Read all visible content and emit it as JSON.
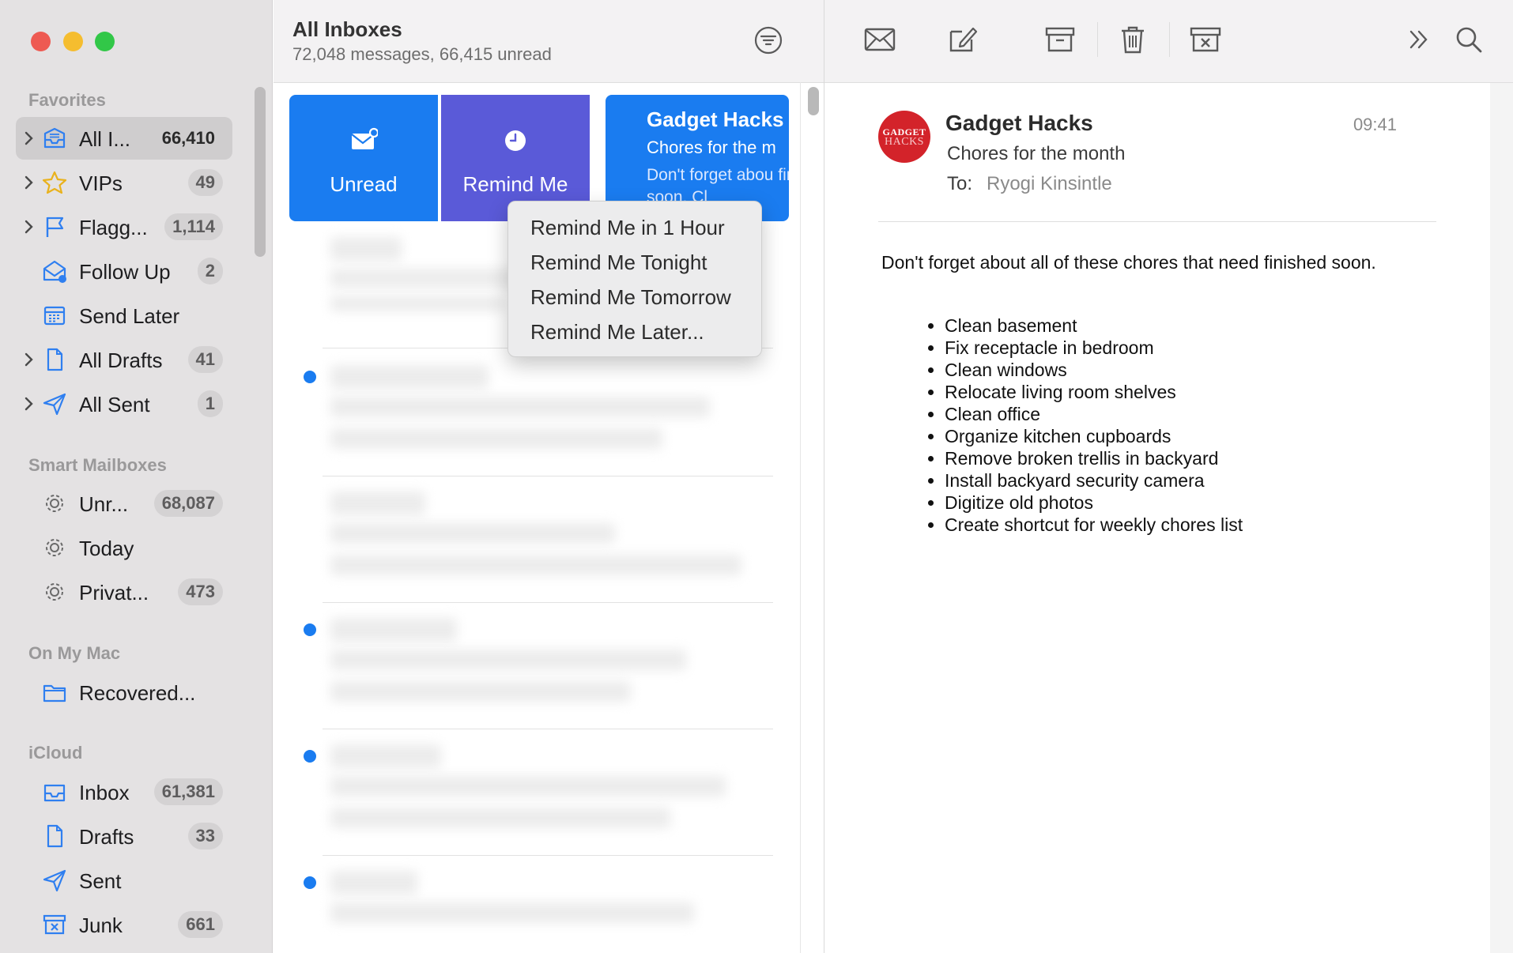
{
  "sidebar": {
    "sections": {
      "favorites": "Favorites",
      "smart": "Smart Mailboxes",
      "onmymac": "On My Mac",
      "icloud": "iCloud"
    },
    "favorites": [
      {
        "label": "All I...",
        "count": "66,410",
        "icon": "inbox-tray-icon"
      },
      {
        "label": "VIPs",
        "count": "49",
        "icon": "star-icon"
      },
      {
        "label": "Flagg...",
        "count": "1,114",
        "icon": "flag-icon"
      },
      {
        "label": "Follow Up",
        "count": "2",
        "icon": "follow-up-envelope-icon"
      },
      {
        "label": "Send Later",
        "count": "",
        "icon": "calendar-icon"
      },
      {
        "label": "All Drafts",
        "count": "41",
        "icon": "document-icon"
      },
      {
        "label": "All Sent",
        "count": "1",
        "icon": "paper-plane-icon"
      }
    ],
    "smart": [
      {
        "label": "Unr...",
        "count": "68,087",
        "icon": "gear-icon"
      },
      {
        "label": "Today",
        "count": "",
        "icon": "gear-icon"
      },
      {
        "label": "Privat...",
        "count": "473",
        "icon": "gear-icon"
      }
    ],
    "onmymac": [
      {
        "label": "Recovered...",
        "count": "",
        "icon": "folder-icon"
      }
    ],
    "icloud": [
      {
        "label": "Inbox",
        "count": "61,381",
        "icon": "inbox-tray-icon"
      },
      {
        "label": "Drafts",
        "count": "33",
        "icon": "document-icon"
      },
      {
        "label": "Sent",
        "count": "",
        "icon": "paper-plane-icon"
      },
      {
        "label": "Junk",
        "count": "661",
        "icon": "junk-box-icon"
      }
    ]
  },
  "list": {
    "title": "All Inboxes",
    "subtitle": "72,048 messages, 66,415 unread",
    "swipe_unread": "Unread",
    "swipe_remind": "Remind Me",
    "preview": {
      "from": "Gadget Hacks",
      "subject": "Chores for the m",
      "body": "Don't forget abou finished soon. Cl"
    }
  },
  "menu": {
    "items": [
      "Remind Me in 1 Hour",
      "Remind Me Tonight",
      "Remind Me Tomorrow",
      "Remind Me Later..."
    ]
  },
  "toolbar": {
    "buttons": [
      "get-mail-icon",
      "compose-icon",
      "archive-icon",
      "trash-icon",
      "junk-icon",
      "more-chevrons-icon",
      "search-icon"
    ]
  },
  "message": {
    "avatar_top": "GADGET",
    "avatar_bottom": "HACKS",
    "from": "Gadget Hacks",
    "time": "09:41",
    "subject": "Chores for the month",
    "to_label": "To:",
    "to": "Ryogi Kinsintle",
    "body": "Don't forget about all of these chores that need finished soon.",
    "chores": [
      "Clean basement",
      "Fix receptacle in bedroom",
      "Clean windows",
      "Relocate living room shelves",
      "Clean office",
      "Organize kitchen cupboards",
      "Remove broken trellis in backyard",
      "Install backyard security camera",
      "Digitize old photos",
      "Create shortcut for weekly chores list"
    ]
  },
  "colors": {
    "accent": "#1a7cf0",
    "remind": "#5a5ad8",
    "avatar": "#d3232a",
    "sidebar_bg": "#e4e2e3"
  }
}
